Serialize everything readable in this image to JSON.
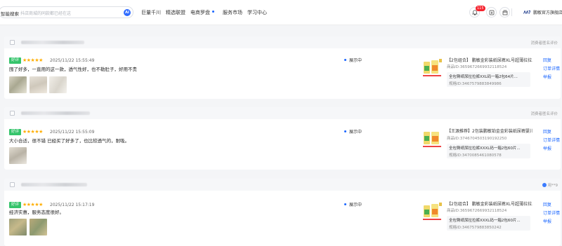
{
  "search": {
    "label": "智能搜索",
    "placeholder": "抖店商城的同款都已经在这",
    "ai_badge": "AI"
  },
  "nav": [
    {
      "label": "巨量千川"
    },
    {
      "label": "精选联盟"
    },
    {
      "label": "电商罗盘"
    },
    {
      "label": "服务市场"
    },
    {
      "label": "学习中心"
    }
  ],
  "header": {
    "notification_count": "115",
    "shop_name": "鹏敏官方旗舰店"
  },
  "reviews": [
    {
      "head_right": "消费者匿名评价",
      "tag": "好评",
      "stars": "★★★★★",
      "time": "2025/11/22 15:55:49",
      "content": "囤了好多，一直用的这一款，透气性好，也不勒肚子，好用不贵",
      "status": "展示中",
      "product_title": "【2包组合】 鹏敏金彩装纸尿裤XL号超薄拉拉...",
      "product_id": "商品ID:3659672669932118524",
      "sku_name": "全包臀纸尿拉拉裤XXL码一箱2包64片...",
      "sku_id": "规格ID:3467579883849986",
      "actions": [
        "回复",
        "订单详情",
        "举报"
      ]
    },
    {
      "head_right": "消费者匿名评价",
      "tag": "好评",
      "stars": "★★★★★",
      "time": "2025/11/22 15:55:09",
      "content": "大小合适，很不错 已经买了好多了，也比较透气的，耐吸。",
      "status": "展示中",
      "product_title": "【王源推荐】2包装鹏敏铂金金彩装纸尿裤婴儿...",
      "product_id": "商品ID:3746704503190192250",
      "sku_name": "全包臀纸尿拉拉裤XXXL码一箱2包60片...",
      "sku_id": "规格ID:3470085461080578",
      "actions": [
        "回复",
        "订单详情",
        "举报"
      ]
    },
    {
      "head_right": "用**9",
      "tag": "好评",
      "stars": "★★★★★",
      "time": "2025/11/22 15:17:19",
      "content": "经济实惠，服务态度很好。",
      "status": "展示中",
      "product_title": "【2包组合】 鹏敏金彩装纸尿裤XL号超薄拉拉...",
      "product_id": "商品ID:3659672669932118524",
      "sku_name": "全包臀纸尿拉拉裤XXXL码一箱2包60片...",
      "sku_id": "规格ID:3467579883850242",
      "actions": [
        "回复",
        "订单详情",
        "举报"
      ]
    }
  ],
  "colors": {
    "accent": "#1a66ff",
    "good_tag": "#35c46b",
    "star": "#ffae00",
    "badge": "#f5222d"
  }
}
